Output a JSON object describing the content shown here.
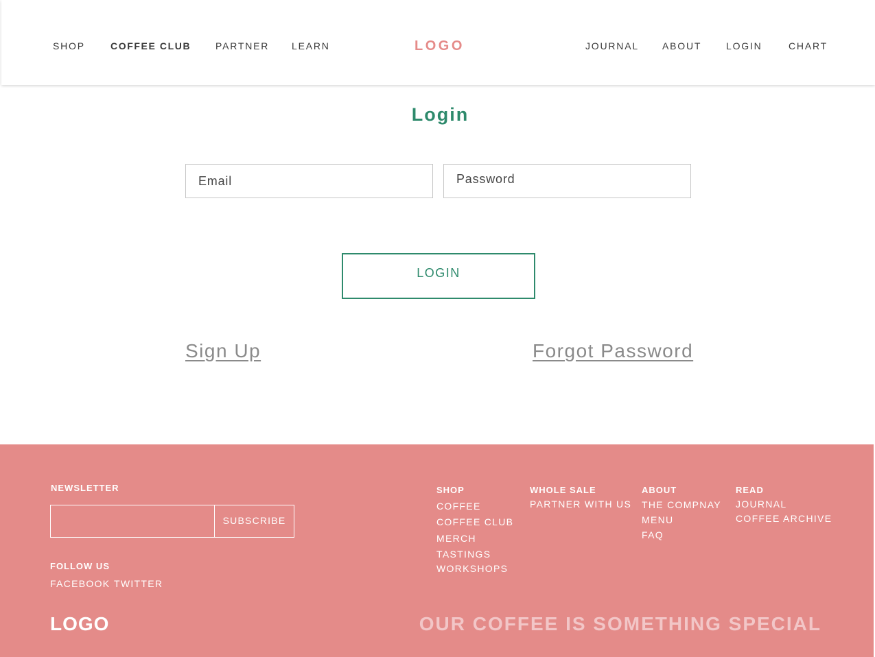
{
  "colors": {
    "accent_green": "#2e8a6c",
    "brand_pink": "#e58b89",
    "footer_background": "#e48b89",
    "tagline_color": "#f2c6c7"
  },
  "header": {
    "nav_left": [
      {
        "label": "SHOP",
        "active": false
      },
      {
        "label": "COFFEE CLUB",
        "active": true
      },
      {
        "label": "PARTNER",
        "active": false
      },
      {
        "label": "LEARN",
        "active": false
      }
    ],
    "logo": "LOGO",
    "nav_right": [
      {
        "label": "JOURNAL"
      },
      {
        "label": "ABOUT"
      },
      {
        "label": "LOGIN"
      },
      {
        "label": "CHART"
      }
    ]
  },
  "login": {
    "title": "Login",
    "email_placeholder": "Email",
    "password_placeholder": "Password",
    "submit_label": "LOGIN",
    "signup_link": "Sign Up",
    "forgot_link": "Forgot Password"
  },
  "footer": {
    "newsletter_heading": "NEWSLETTER",
    "newsletter_value": "",
    "subscribe_label": "SUBSCRIBE",
    "follow_heading": "FOLLOW US",
    "social": [
      "FACEBOOK",
      "TWITTER"
    ],
    "columns": [
      {
        "heading": "SHOP",
        "links": [
          "COFFEE",
          "COFFEE CLUB",
          "MERCH",
          "TASTINGS",
          "WORKSHOPS"
        ]
      },
      {
        "heading": "WHOLE SALE",
        "links": [
          "PARTNER WITH US"
        ]
      },
      {
        "heading": "ABOUT",
        "links": [
          "THE COMPNAY",
          "MENU",
          "FAQ"
        ]
      },
      {
        "heading": "READ",
        "links": [
          "JOURNAL",
          "COFFEE ARCHIVE"
        ]
      }
    ],
    "logo": "LOGO",
    "tagline": "OUR COFFEE IS SOMETHING SPECIAL"
  }
}
